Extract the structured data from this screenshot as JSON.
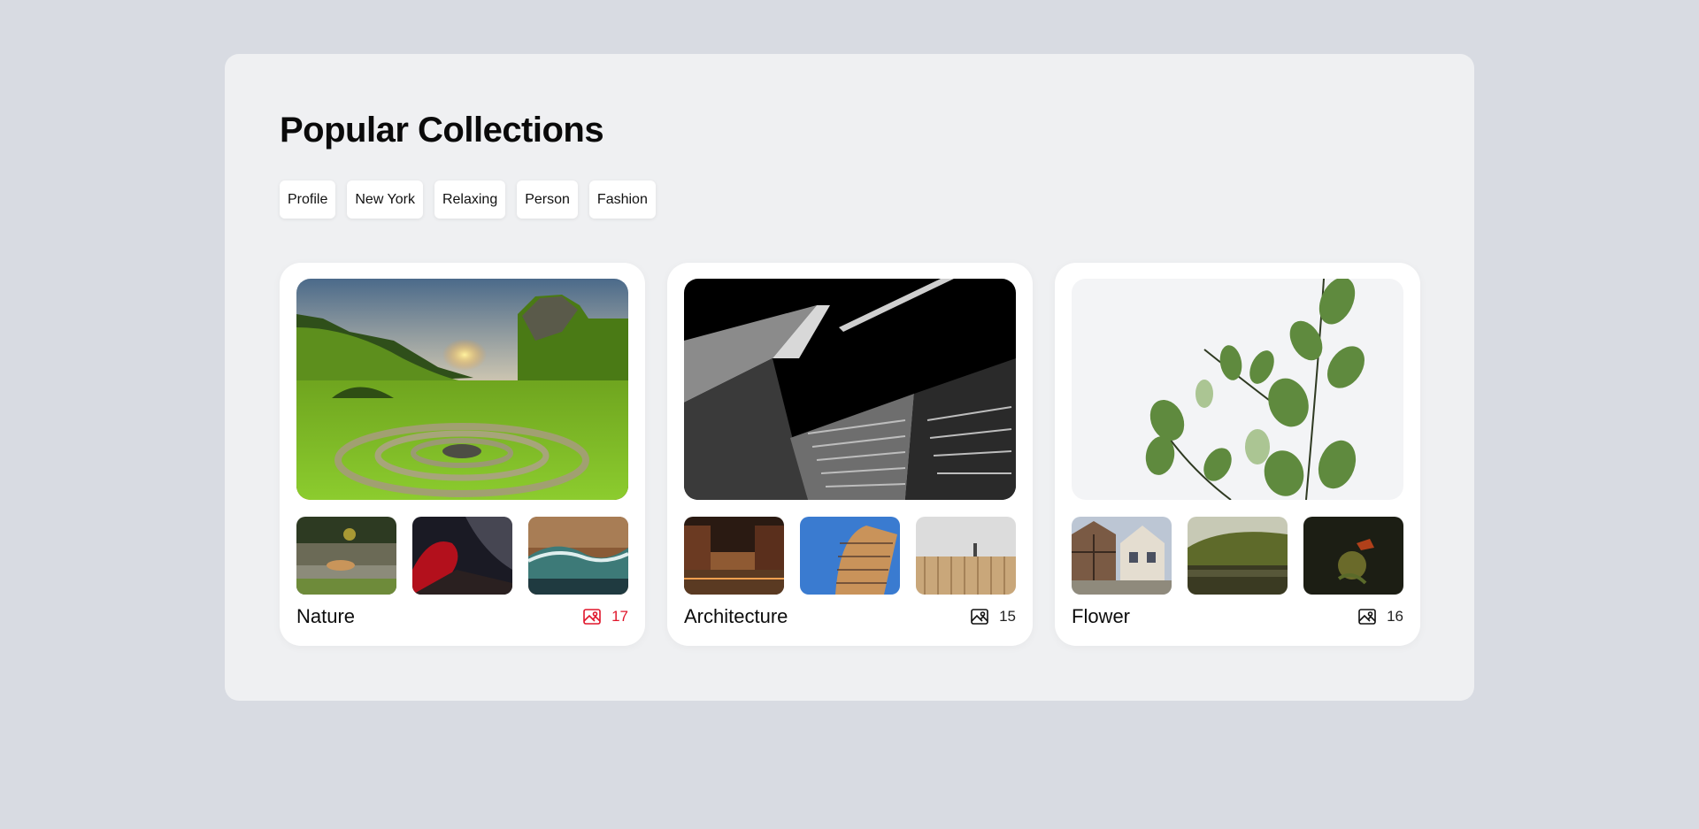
{
  "page": {
    "title": "Popular Collections"
  },
  "tags": [
    "Profile",
    "New York",
    "Relaxing",
    "Person",
    "Fashion"
  ],
  "collections": [
    {
      "name": "Nature",
      "count": "17",
      "accent": "#e0162b",
      "icon": "image-icon",
      "hero": "green valley with stone spiral at sunset",
      "thumbs": [
        "fox resting on road",
        "milky way over red-lit rocks",
        "ocean wave"
      ]
    },
    {
      "name": "Architecture",
      "count": "15",
      "icon": "image-icon",
      "hero": "black and white skyscraper looking up",
      "thumbs": [
        "canal city at night",
        "round glass tower",
        "building facade with person"
      ]
    },
    {
      "name": "Flower",
      "count": "16",
      "icon": "image-icon",
      "hero": "eucalyptus branch on white",
      "thumbs": [
        "half-timbered houses",
        "lake with green hills",
        "butterfly on flower"
      ]
    }
  ]
}
